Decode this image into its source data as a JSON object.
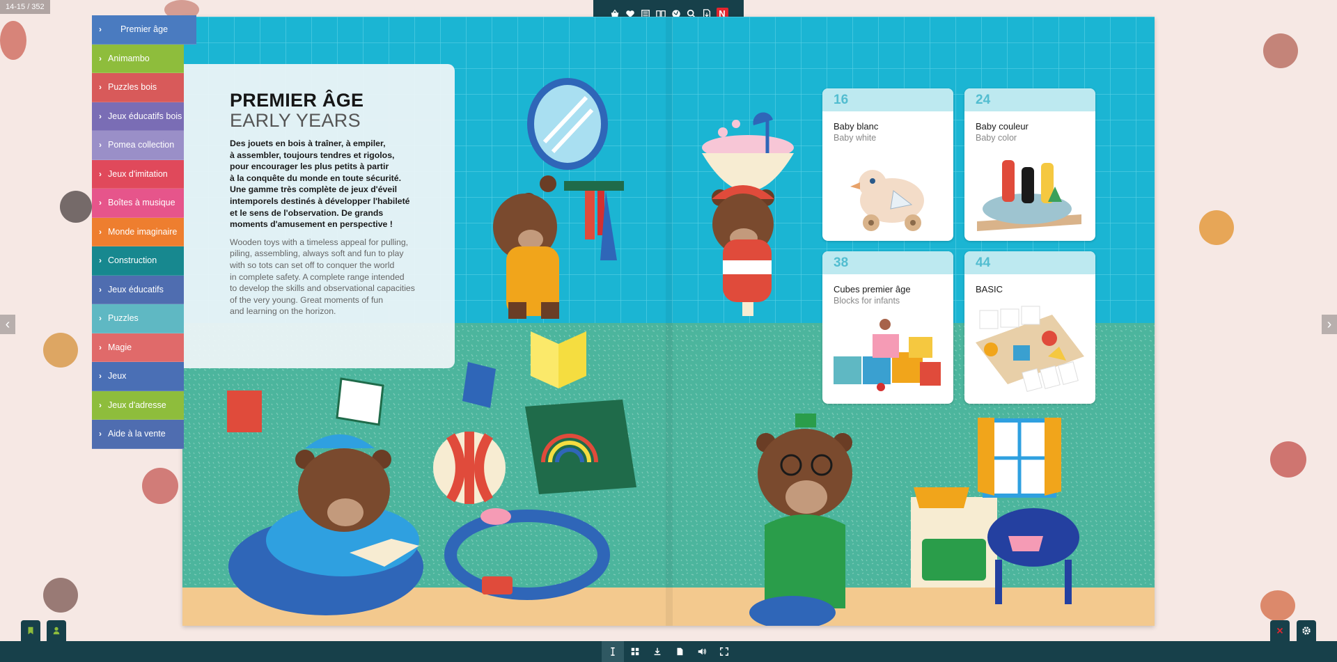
{
  "page_counter": "14-15 / 352",
  "nav": [
    {
      "label": "Premier âge",
      "color": "#4a7bc0"
    },
    {
      "label": "Animambo",
      "color": "#8ebd3c"
    },
    {
      "label": "Puzzles bois",
      "color": "#d85a5a"
    },
    {
      "label": "Jeux éducatifs bois",
      "color": "#7a6db5"
    },
    {
      "label": "Pomea collection",
      "color": "#9a8fc8"
    },
    {
      "label": "Jeux d'imitation",
      "color": "#e0495b"
    },
    {
      "label": "Boîtes à musique",
      "color": "#e6558b"
    },
    {
      "label": "Monde imaginaire",
      "color": "#ee7e2f"
    },
    {
      "label": "Construction",
      "color": "#17888f"
    },
    {
      "label": "Jeux éducatifs",
      "color": "#4f6db0"
    },
    {
      "label": "Puzzles",
      "color": "#5fb8c3"
    },
    {
      "label": "Magie",
      "color": "#e06a6a"
    },
    {
      "label": "Jeux",
      "color": "#4a6fb5"
    },
    {
      "label": "Jeux d'adresse",
      "color": "#8ebd3c"
    },
    {
      "label": "Aide à la vente",
      "color": "#4f6db0"
    }
  ],
  "panel": {
    "title": "PREMIER ÂGE",
    "subtitle": "EARLY YEARS",
    "text_fr": "Des jouets en bois à traîner, à empiler,\nà assembler, toujours tendres et rigolos,\npour encourager les plus petits à partir\nà la conquête du monde en toute sécurité.\nUne gamme très complète de jeux d'éveil\nintemporels destinés à développer l'habileté\net le sens de l'observation. De grands\nmoments d'amusement en perspective !",
    "text_en": "Wooden toys with a timeless appeal for pulling,\npiling, assembling, always soft and fun to play\nwith so tots can set off to conquer the world\nin complete safety. A complete range intended\nto develop the skills and observational capacities\nof the very young. Great moments of fun\nand learning on the horizon."
  },
  "cards": [
    {
      "page": "16",
      "title": "Baby blanc",
      "subtitle": "Baby white"
    },
    {
      "page": "24",
      "title": "Baby couleur",
      "subtitle": "Baby color"
    },
    {
      "page": "38",
      "title": "Cubes premier âge",
      "subtitle": "Blocks for infants"
    },
    {
      "page": "44",
      "title": "BASIC",
      "subtitle": ""
    }
  ],
  "toolbar_icons": [
    "basket-icon",
    "heart-icon",
    "list-icon",
    "open-book-icon",
    "globe-icon",
    "search-icon",
    "pdf-icon",
    "n-logo-icon"
  ],
  "toolbar_logo_letter": "N",
  "bottom_icons": [
    "text-cursor-icon",
    "grid-icon",
    "download-icon",
    "page-icon",
    "speaker-icon",
    "fullscreen-icon"
  ]
}
